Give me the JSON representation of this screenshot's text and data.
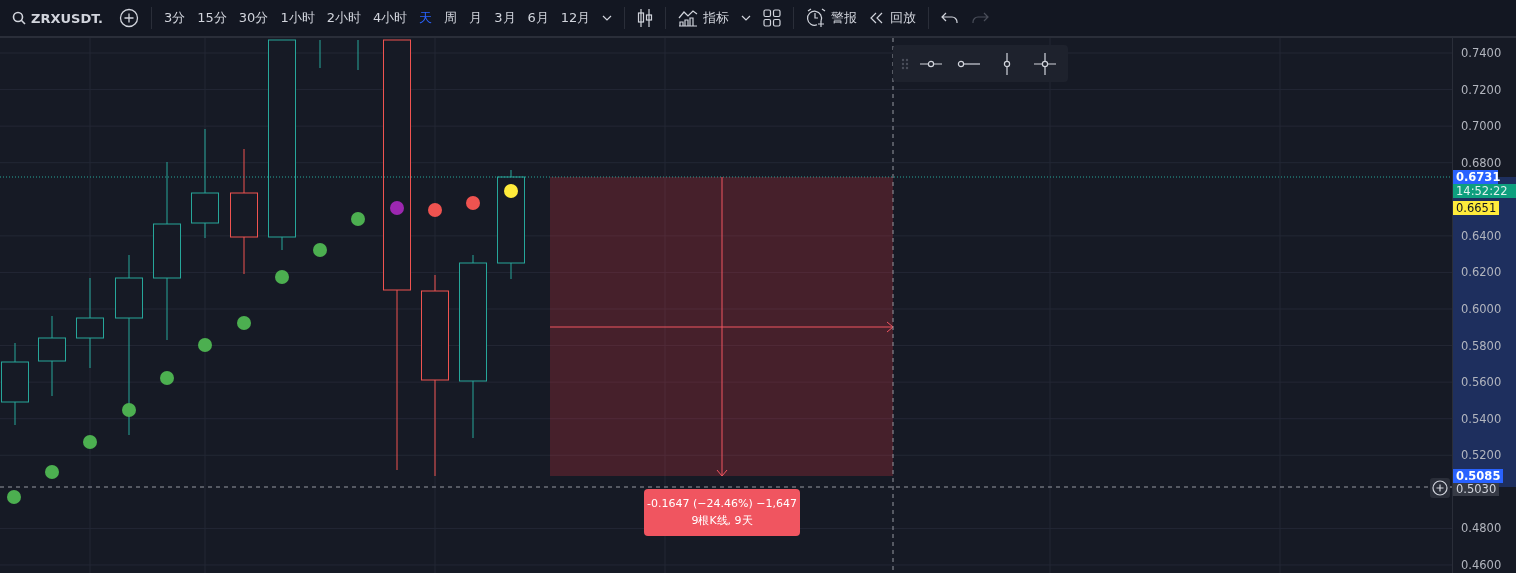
{
  "toolbar": {
    "symbol": "ZRXUSDT.",
    "intervals": [
      {
        "label": "3分",
        "selected": false
      },
      {
        "label": "15分",
        "selected": false
      },
      {
        "label": "30分",
        "selected": false
      },
      {
        "label": "1小时",
        "selected": false
      },
      {
        "label": "2小时",
        "selected": false
      },
      {
        "label": "4小时",
        "selected": false
      },
      {
        "label": "天",
        "selected": true
      },
      {
        "label": "周",
        "selected": false
      },
      {
        "label": "月",
        "selected": false
      },
      {
        "label": "3月",
        "selected": false
      },
      {
        "label": "6月",
        "selected": false
      },
      {
        "label": "12月",
        "selected": false
      }
    ],
    "indicators": "指标",
    "alert": "警报",
    "replay": "回放"
  },
  "price_axis": {
    "ticks": [
      "0.7400",
      "0.7200",
      "0.7000",
      "0.6800",
      "0.6400",
      "0.6200",
      "0.6000",
      "0.5800",
      "0.5600",
      "0.5400",
      "0.5200",
      "0.4800",
      "0.4600"
    ],
    "last_price": "0.6731",
    "countdown": "14:52:22",
    "indicator_price": "0.6651",
    "range_low": "0.5085",
    "crosshair_price": "0.5030"
  },
  "measure": {
    "change": "-0.1647 (−24.46%) −1,647",
    "span": "9根K线, 9天"
  }
}
